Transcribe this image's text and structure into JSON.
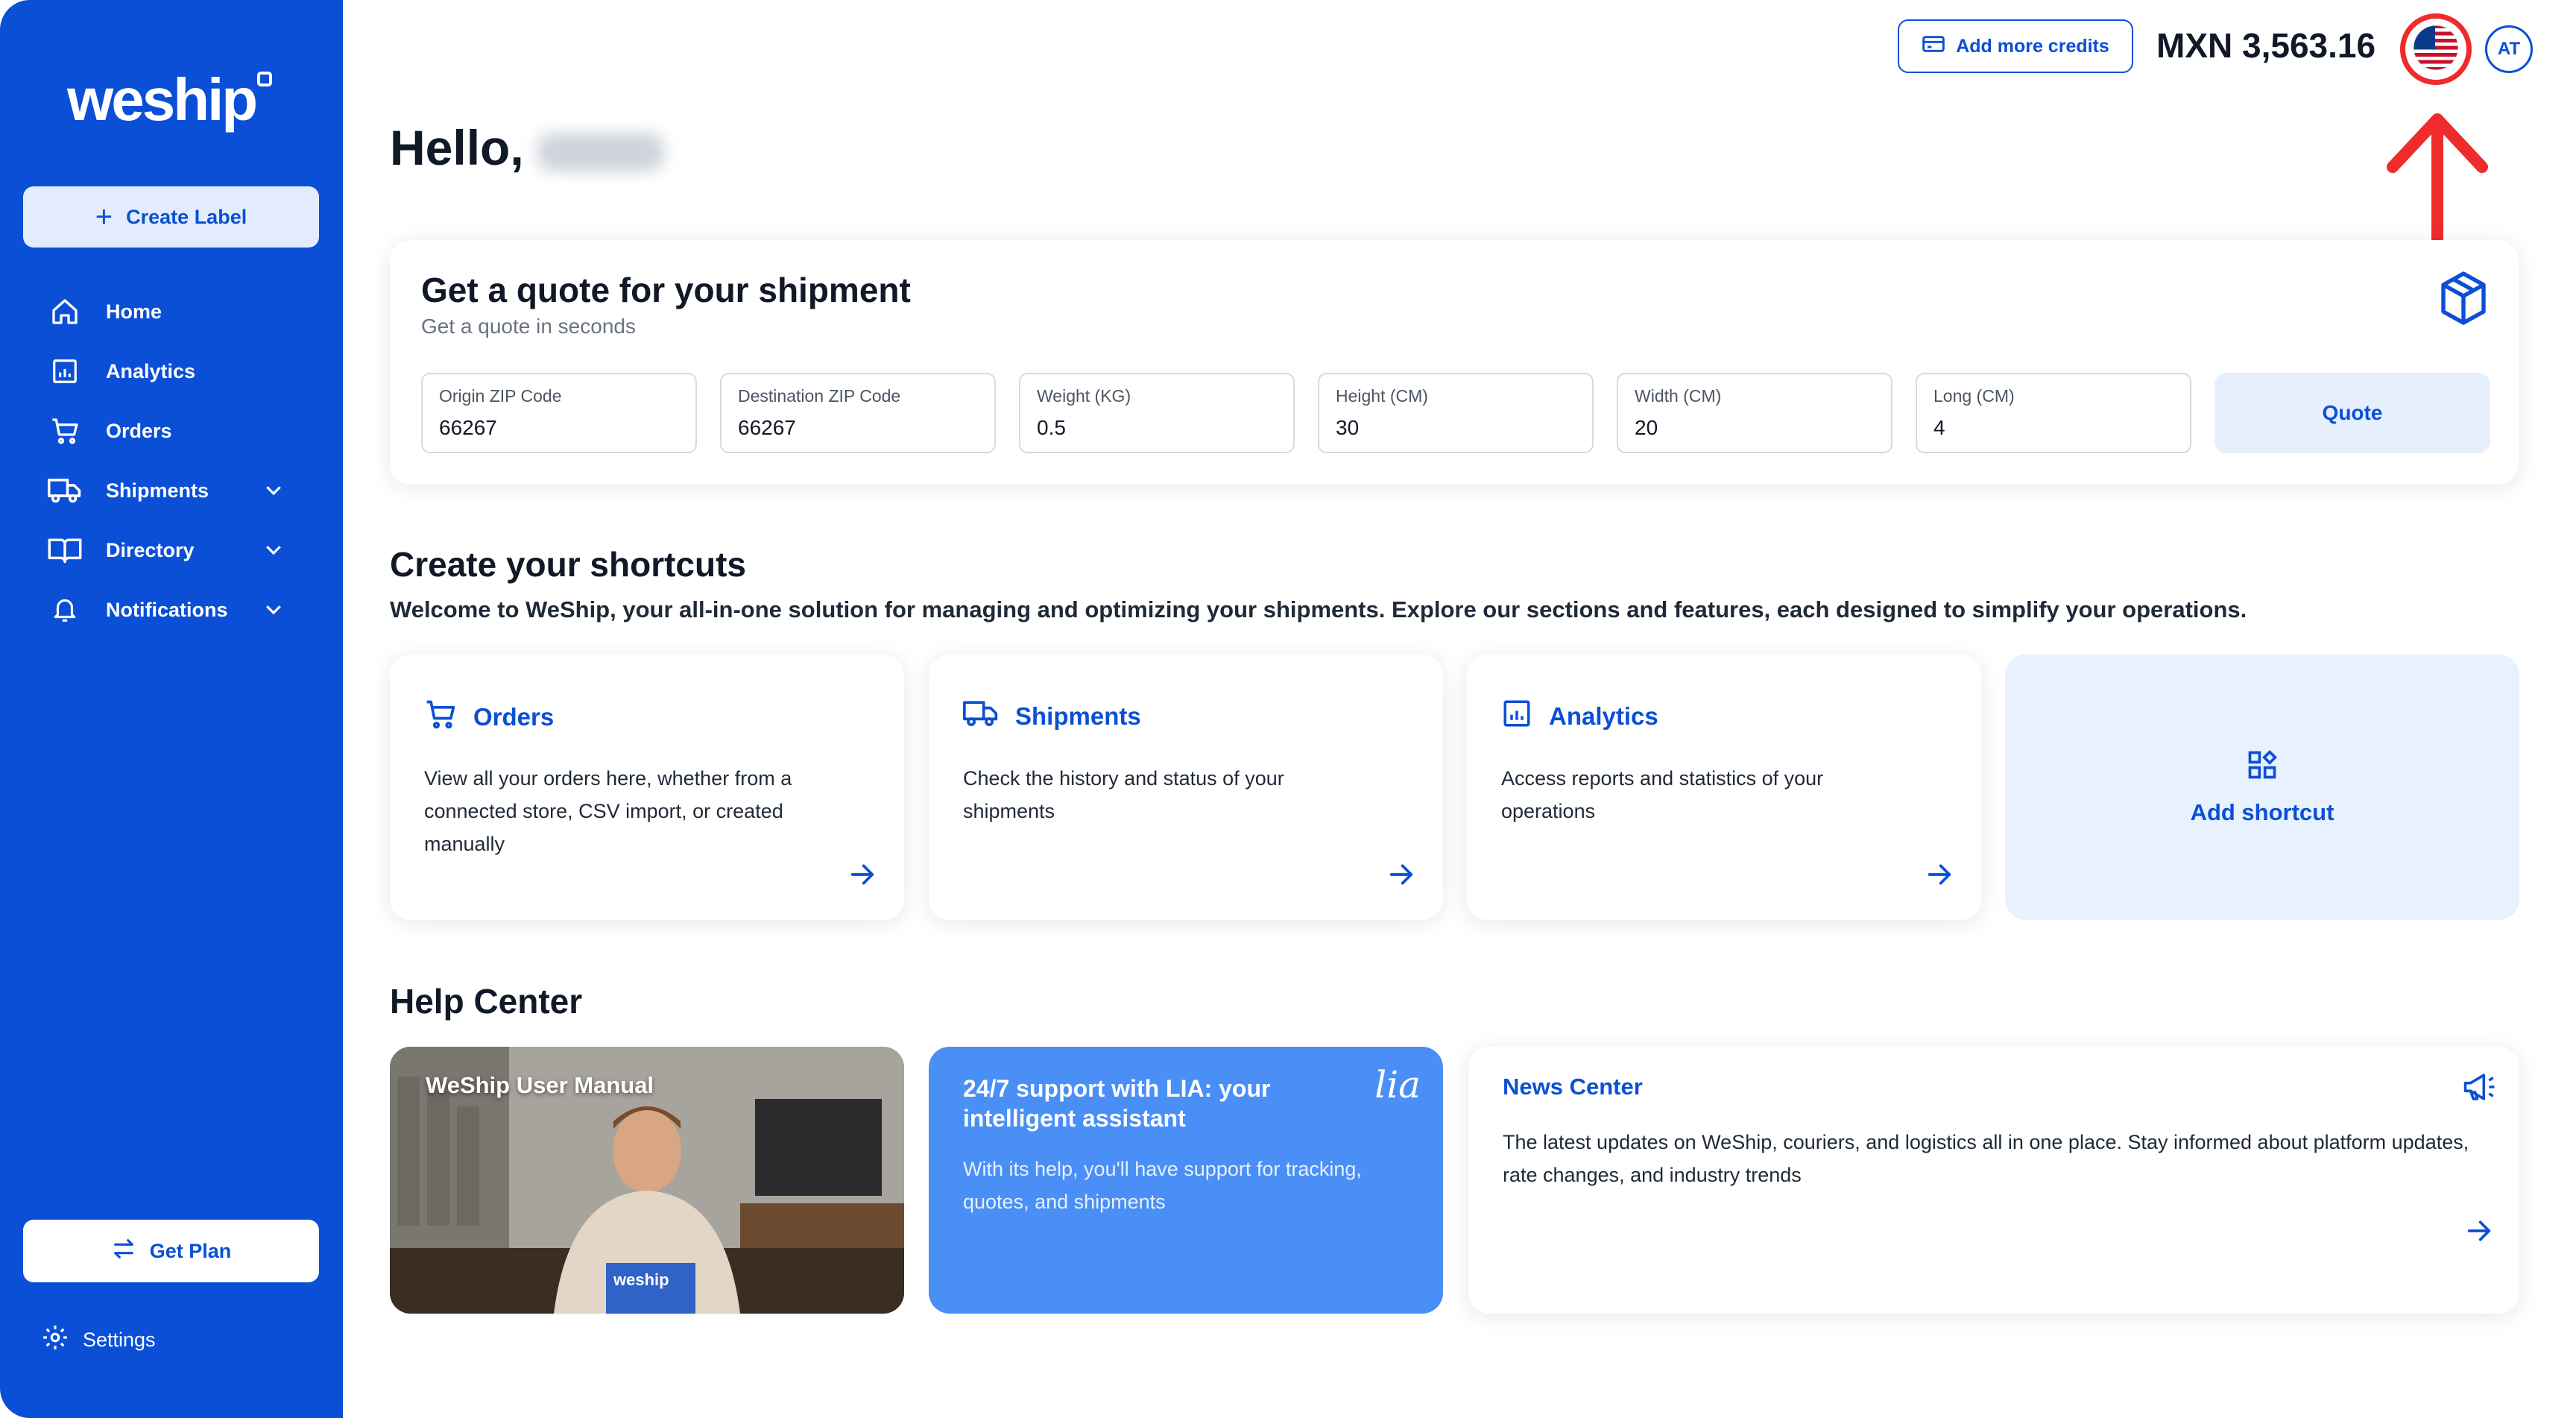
{
  "app": {
    "logo": "weship"
  },
  "sidebar": {
    "create_label": "Create Label",
    "items": [
      {
        "label": "Home",
        "icon": "home-icon"
      },
      {
        "label": "Analytics",
        "icon": "analytics-icon"
      },
      {
        "label": "Orders",
        "icon": "cart-icon"
      },
      {
        "label": "Shipments",
        "icon": "truck-icon",
        "expandable": true
      },
      {
        "label": "Directory",
        "icon": "book-icon",
        "expandable": true
      },
      {
        "label": "Notifications",
        "icon": "bell-icon",
        "expandable": true
      }
    ],
    "get_plan": "Get Plan",
    "settings": "Settings"
  },
  "topbar": {
    "add_credits": "Add more credits",
    "balance": "MXN 3,563.16",
    "language_flag": "us-flag-icon",
    "avatar_initials": "AT"
  },
  "greeting": {
    "text": "Hello,"
  },
  "quote": {
    "title": "Get a quote for your shipment",
    "subtitle": "Get a quote in seconds",
    "fields": [
      {
        "label": "Origin ZIP Code",
        "value": "66267"
      },
      {
        "label": "Destination ZIP Code",
        "value": "66267"
      },
      {
        "label": "Weight (KG)",
        "value": "0.5"
      },
      {
        "label": "Height (CM)",
        "value": "30"
      },
      {
        "label": "Width (CM)",
        "value": "20"
      },
      {
        "label": "Long (CM)",
        "value": "4"
      }
    ],
    "button": "Quote"
  },
  "shortcuts": {
    "title": "Create your shortcuts",
    "description": "Welcome to WeShip, your all-in-one solution for managing and optimizing your shipments. Explore our sections and features, each designed to simplify your operations.",
    "cards": [
      {
        "title": "Orders",
        "description": "View all your orders here, whether from a connected store, CSV import, or created manually"
      },
      {
        "title": "Shipments",
        "description": "Check the history and status of your shipments"
      },
      {
        "title": "Analytics",
        "description": "Access reports and statistics of your operations"
      }
    ],
    "add": "Add shortcut"
  },
  "help": {
    "title": "Help Center",
    "manual": {
      "title": "WeShip User Manual",
      "box_text": "weship"
    },
    "lia": {
      "title": "24/7 support with LIA: your intelligent assistant",
      "description": "With its help, you'll have support for tracking, quotes, and shipments",
      "logo": "lia"
    },
    "news": {
      "title": "News Center",
      "description": "The latest updates on WeShip, couriers, and logistics all in one place. Stay informed about platform updates, rate changes, and industry trends"
    }
  },
  "colors": {
    "brand": "#0a4fd6",
    "highlight": "#ef2b2b",
    "light_blue": "#e5effe"
  }
}
